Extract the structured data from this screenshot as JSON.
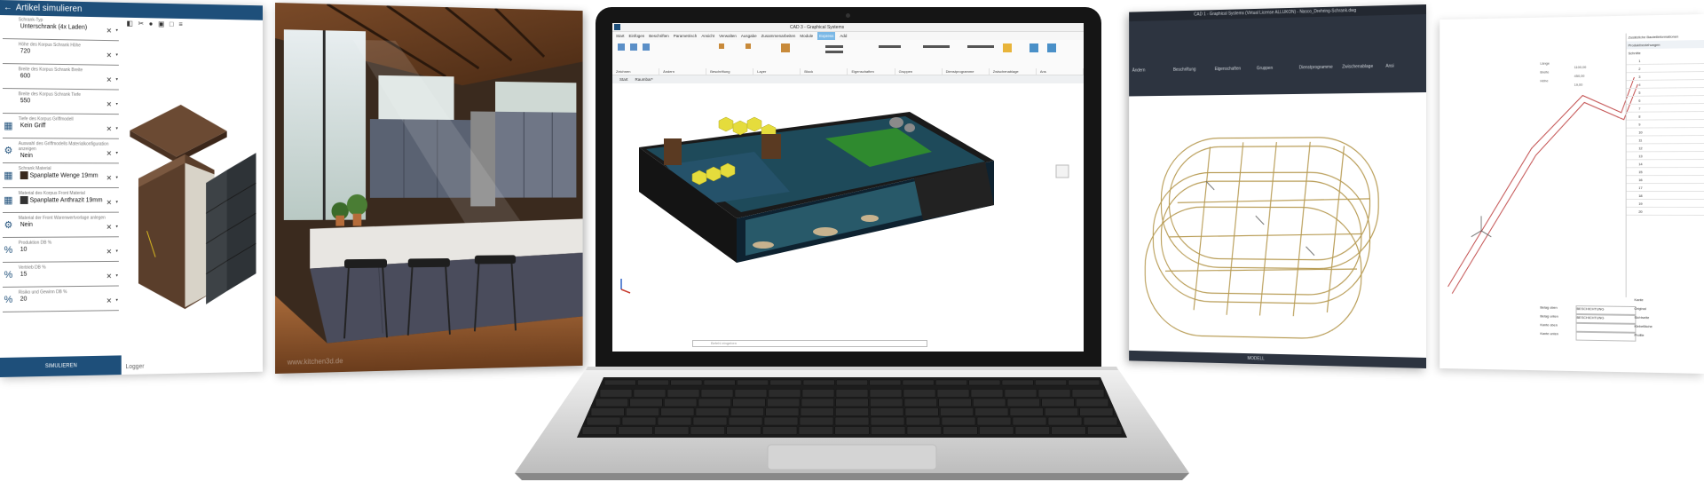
{
  "left_panel": {
    "title": "Artikel simulieren",
    "fields": [
      {
        "label": "Schrank-Typ",
        "value": "Unterschrank (4x Laden)",
        "icon": "none"
      },
      {
        "label": "Höhe des Korpus\nSchrank Höhe",
        "value": "720",
        "icon": "none"
      },
      {
        "label": "Breite des Korpus\nSchrank Breite",
        "value": "600",
        "icon": "none"
      },
      {
        "label": "Breite des Korpus\nSchrank Tiefe",
        "value": "550",
        "icon": "none"
      },
      {
        "label": "Tiefe des Korpus\nGriffmodell",
        "value": "Kein Griff",
        "icon": "texture"
      },
      {
        "label": "Auswahl des Griffmodells\nMaterialkonfiguration anzeigen",
        "value": "Nein",
        "icon": "gear"
      },
      {
        "label": "Schrank Material",
        "value": "Spanplatte Wenge 19mm",
        "icon": "texture",
        "swatch": "#3a2a1e"
      },
      {
        "label": "Material des Korpus\nFront Material",
        "value": "Spanplatte Anthrazit 19mm",
        "icon": "texture",
        "swatch": "#333333"
      },
      {
        "label": "Material der Front\nWarenwertvorlage anlegen",
        "value": "Nein",
        "icon": "gear"
      },
      {
        "label": "Produktion DB %",
        "value": "10",
        "icon": "percent"
      },
      {
        "label": "Vertrieb DB %",
        "value": "15",
        "icon": "percent"
      },
      {
        "label": "Risiko und Gewinn DB %",
        "value": "20",
        "icon": "percent"
      }
    ],
    "simulate_button": "SIMULIEREN",
    "logger": "Logger"
  },
  "kitchen_render": {
    "caption": "www.kitchen3d.de"
  },
  "laptop": {
    "app_title": "CAD 3 - Graphical Systems",
    "menu_tabs": [
      "Start",
      "Einfügen",
      "Beschriften",
      "Parametrisch",
      "Ansicht",
      "Verwalten",
      "Ausgabe",
      "Zusammenarbeiten",
      "Module",
      "Express",
      "Add"
    ],
    "active_tab": "Express",
    "ribbon_groups": [
      "Zeichnen",
      "Ändern",
      "Beschriftung",
      "Layer",
      "Block",
      "Eigenschaften",
      "Gruppen",
      "Dienstprogramme",
      "Zwischenablage",
      "Ans"
    ],
    "doc_tabs": [
      "Start",
      "Raumbar*"
    ],
    "cmd_placeholder": "Befehl eingeben"
  },
  "cad_right": {
    "title": "CAD 1 - Graphical Systems (Virtual License ALLUKON) - Nasco_Drehring-Schrank.dwg",
    "ribbon_groups": [
      "Ändern",
      "Beschriftung",
      "Eigenschaften",
      "Gruppen",
      "Dienstprogramme",
      "Zwischenablage",
      "Ansi"
    ],
    "status": "MODELL"
  },
  "doc_right": {
    "header": "Zusätzliche Bauteilinformationen",
    "subheader": "Produktbeziehungen",
    "section": "Schnitte",
    "rows": [
      "1",
      "2",
      "3",
      "4",
      "5",
      "6",
      "7",
      "8",
      "9",
      "10",
      "11",
      "12",
      "13",
      "14",
      "15",
      "16",
      "17",
      "18",
      "19",
      "20"
    ],
    "dim_labels": [
      "Länge",
      "Breite",
      "Höhe"
    ],
    "dim_values": [
      "1100,00",
      "450,00",
      "19,00"
    ],
    "bottom_labels": [
      "Belag oben",
      "Belag unten",
      "Kante oben",
      "Kante unten"
    ],
    "bottom_values": [
      "BESCHICHTUNG",
      "BESCHICHTUNG",
      "",
      ""
    ],
    "right_labels": [
      "Kante",
      "Original",
      "Sichtseite",
      "Klebefläche",
      "Profile"
    ]
  },
  "colors": {
    "panel_blue": "#1e4f7a",
    "cad_dark": "#2d3440",
    "floor_teal": "#1e4a5a",
    "carpet_green": "#2f8a2f",
    "hex_yellow": "#e5dc3c"
  }
}
